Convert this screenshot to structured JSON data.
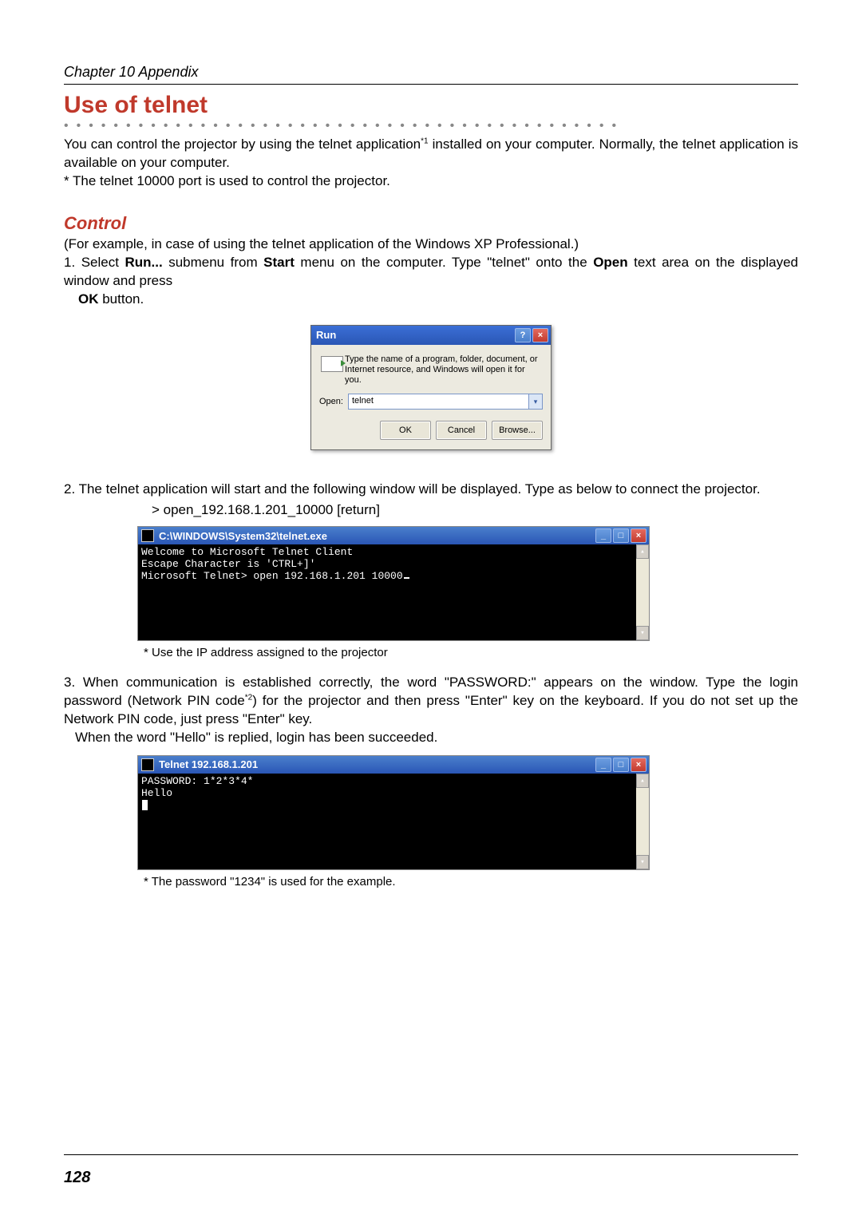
{
  "chapter_header": "Chapter 10 Appendix",
  "section_title": "Use of telnet",
  "intro_1": "You can control the projector by using the telnet application",
  "intro_sup": "*1",
  "intro_2": " installed on your computer.  Normally, the telnet application is available on your computer.",
  "intro_note": "* The telnet 10000 port is used to control the projector.",
  "subsection": "Control",
  "control_line": "(For example, in case of using the telnet application of the Windows XP Professional.)",
  "step1a": "1. Select ",
  "step1b": "Run...",
  "step1c": " submenu from ",
  "step1d": "Start",
  "step1e": " menu on the computer. Type \"telnet\" onto the ",
  "step1f": "Open",
  "step1g": " text area on the displayed window and press ",
  "step1h": "OK",
  "step1i": " button.",
  "run_dialog": {
    "title": "Run",
    "desc": "Type the name of a program, folder, document, or Internet resource, and Windows will open it for you.",
    "open_label": "Open:",
    "open_value": "telnet",
    "ok": "OK",
    "cancel": "Cancel",
    "browse": "Browse..."
  },
  "step2": "2. The telnet application will start and the following window will be displayed. Type as below to connect the projector.",
  "step2_code": "> open_192.168.1.201_10000 [return]",
  "console1": {
    "title": "C:\\WINDOWS\\System32\\telnet.exe",
    "line1": "Welcome to Microsoft Telnet Client",
    "line2": "Escape Character is 'CTRL+]'",
    "line3": "Microsoft Telnet> open 192.168.1.201 10000"
  },
  "step2_note": "* Use the IP address assigned to the projector",
  "step3a": "3. When communication is established correctly, the word \"PASSWORD:\" appears on the window. Type the login password (Network PIN code",
  "step3_sup": "*2",
  "step3b": ") for the projector and then press \"Enter\" key on the keyboard. If you do not set up the Network PIN code, just press \"Enter\" key.",
  "step3c": "When the word \"Hello\" is replied, login has been succeeded.",
  "console2": {
    "title": "Telnet 192.168.1.201",
    "line1": "PASSWORD: 1*2*3*4*",
    "line2": "Hello"
  },
  "step3_note": "* The password \"1234\" is used for the example.",
  "page_number": "128"
}
